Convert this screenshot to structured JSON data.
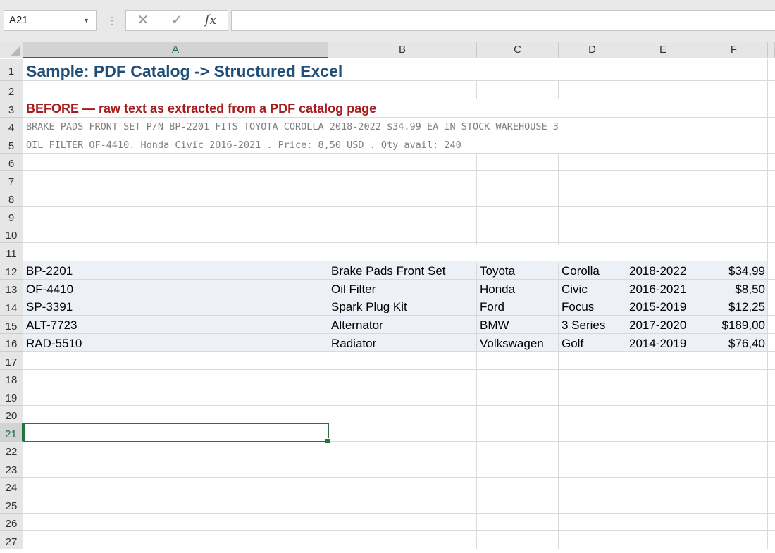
{
  "formula_bar": {
    "name_box": "A21",
    "cancel_glyph": "✕",
    "enter_glyph": "✓",
    "fx_label": "fx",
    "formula": ""
  },
  "columns": [
    "A",
    "B",
    "C",
    "D",
    "E",
    "F"
  ],
  "selected_column": "A",
  "rows": [
    "1",
    "2",
    "3",
    "4",
    "5",
    "6",
    "7",
    "8",
    "9",
    "10",
    "11",
    "12",
    "13",
    "14",
    "15",
    "16",
    "17",
    "18",
    "19",
    "20",
    "21",
    "22",
    "23",
    "24",
    "25",
    "26",
    "27"
  ],
  "selected_row": "21",
  "sheet": {
    "title": "Sample: PDF Catalog -> Structured Excel",
    "before_heading": "BEFORE — raw text as extracted from a PDF catalog page",
    "raw_line_1": "BRAKE PADS FRONT SET P/N BP-2201 FITS TOYOTA COROLLA 2018-2022 $34.99 EA IN STOCK WAREHOUSE 3",
    "raw_line_2": "OIL FILTER  OF-4410. Honda Civic 2016-2021 . Price: 8,50 USD . Qty avail: 240",
    "table": [
      [
        "BP-2201",
        "Brake Pads Front Set",
        "Toyota",
        "Corolla",
        "2018-2022",
        "$34,99"
      ],
      [
        "OF-4410",
        "Oil Filter",
        "Honda",
        "Civic",
        "2016-2021",
        "$8,50"
      ],
      [
        "SP-3391",
        "Spark Plug Kit",
        "Ford",
        "Focus",
        "2015-2019",
        "$12,25"
      ],
      [
        "ALT-7723",
        "Alternator",
        "BMW",
        "3 Series",
        "2017-2020",
        "$189,00"
      ],
      [
        "RAD-5510",
        "Radiator",
        "Volkswagen",
        "Golf",
        "2014-2019",
        "$76,40"
      ]
    ]
  },
  "colors": {
    "accent": "#217346",
    "title": "#1f4e79",
    "before_heading": "#a61c1c",
    "raw_text": "#7f7f7f",
    "table_row_fill": "#eef0f7"
  }
}
